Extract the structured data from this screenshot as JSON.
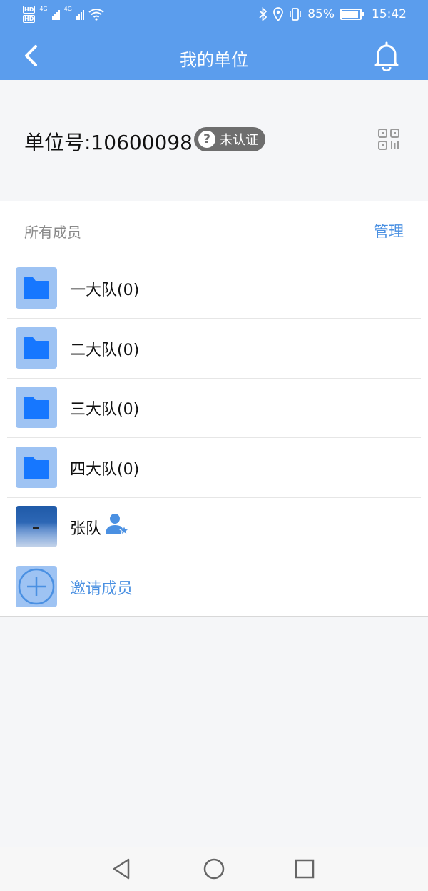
{
  "status_bar": {
    "hd1": "HD",
    "hd2": "HD",
    "net1": "4G",
    "net2": "4G",
    "battery_percent": "85%",
    "battery_level": 0.85,
    "time": "15:42"
  },
  "app_bar": {
    "title": "我的单位"
  },
  "unit": {
    "number_label": "单位号:10600098",
    "status_badge": "未认证",
    "badge_icon": "?"
  },
  "members": {
    "section_label": "所有成员",
    "manage_label": "管理",
    "items": [
      {
        "label": "一大队(0)",
        "icon": "folder-icon"
      },
      {
        "label": "二大队(0)",
        "icon": "folder-icon"
      },
      {
        "label": "三大队(0)",
        "icon": "folder-icon"
      },
      {
        "label": "四大队(0)",
        "icon": "folder-icon"
      },
      {
        "label": "张队",
        "icon": "avatar-photo"
      }
    ],
    "invite_label": "邀请成员"
  },
  "colors": {
    "accent": "#5b9ded",
    "link": "#4a90e2",
    "folder": "#1677ff",
    "folder_bg": "#9ec3f3"
  }
}
